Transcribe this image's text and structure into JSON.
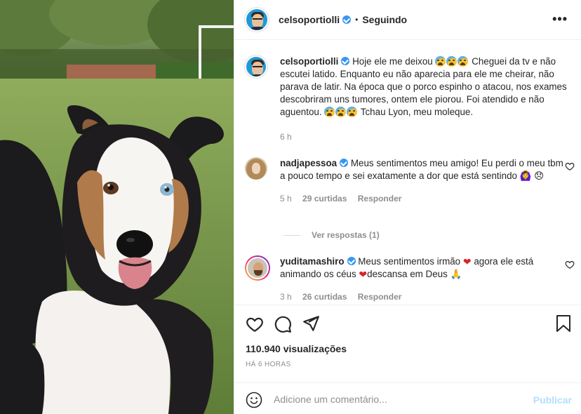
{
  "post": {
    "username": "celsoportiolli",
    "follow_state": "Seguindo",
    "separator": "•",
    "more_label": "•••"
  },
  "caption": {
    "username": "celsoportiolli",
    "text_1": "Hoje ele me deixou",
    "text_2": "Cheguei da tv e não escutei latido. Enquanto eu não aparecia para ele me cheirar, não parava de latir. Na época que o porco espinho o atacou, nos exames descobriram uns tumores, ontem ele piorou. Foi atendido e não aguentou.",
    "text_3": "Tchau Lyon, meu moleque.",
    "time": "6 h"
  },
  "comments": [
    {
      "username": "nadjapessoa",
      "text": "Meus sentimentos meu amigo! Eu perdi o meu tbm a pouco tempo e sei exatamente a dor que está sentindo",
      "emojis": "🙆‍♀️ 😞",
      "time": "5 h",
      "likes": "29 curtidas",
      "reply": "Responder",
      "view_replies": "Ver respostas (1)"
    },
    {
      "username": "yuditamashiro",
      "text_1": "Meus sentimentos irmão",
      "text_2": "agora ele está animando os céus",
      "text_3": "descansa em Deus",
      "time": "3 h",
      "likes": "26 curtidas",
      "reply": "Responder"
    }
  ],
  "stats": {
    "views": "110.940 visualizações",
    "posted_ago": "HÁ 6 HORAS"
  },
  "comment_box": {
    "placeholder": "Adicione um comentário...",
    "publish_label": "Publicar"
  },
  "icons": {
    "like": "heart-outline-icon",
    "comment": "comment-bubble-icon",
    "share": "paper-plane-icon",
    "save": "bookmark-icon",
    "emoji": "smiley-icon",
    "more": "ellipsis-icon",
    "verified": "verified-badge-icon"
  },
  "colors": {
    "verified": "#3897f0",
    "link_disabled": "#b2dffc",
    "meta_gray": "#8e8e8e"
  }
}
